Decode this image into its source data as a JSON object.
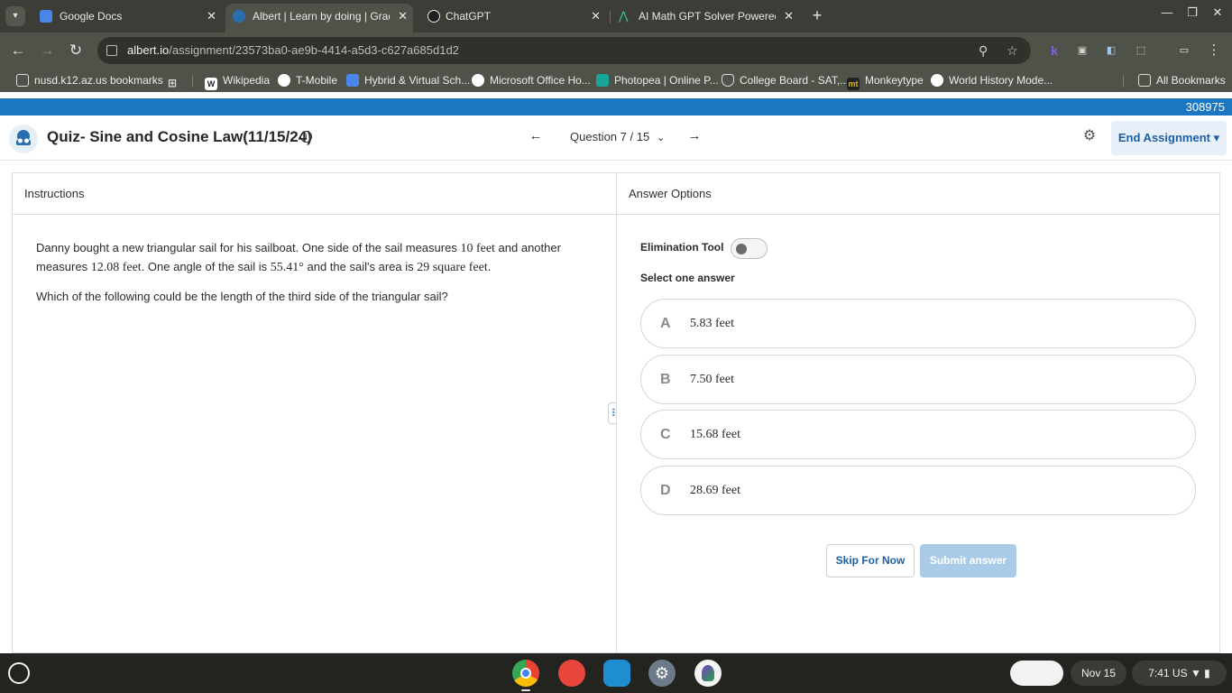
{
  "browser": {
    "tabs": [
      {
        "title": "Google Docs",
        "active": false
      },
      {
        "title": "Albert | Learn by doing | Grades",
        "active": true
      },
      {
        "title": "ChatGPT",
        "active": false
      },
      {
        "title": "AI Math GPT Solver Powered by",
        "active": false
      }
    ],
    "url_host": "albert.io",
    "url_path": "/assignment/23573ba0-ae9b-4414-a5d3-c627a685d1d2",
    "bookmarks": [
      "nusd.k12.az.us bookmarks",
      "Wikipedia",
      "T-Mobile",
      "Hybrid & Virtual Sch...",
      "Microsoft Office Ho...",
      "Photopea | Online P...",
      "College Board - SAT,...",
      "Monkeytype",
      "World History Mode...",
      "All Bookmarks"
    ]
  },
  "page": {
    "top_code": "308975",
    "header": {
      "title": "Quiz- Sine and Cosine Law(11/15/24)",
      "question_nav": "Question 7 / 15",
      "end_label": "End Assignment"
    },
    "instructions": {
      "heading": "Instructions",
      "p1_a": "Danny bought a new triangular sail for his sailboat. One side of the sail measures ",
      "p1_m1": "10 feet",
      "p1_b": " and another measures ",
      "p1_m2": "12.08 feet",
      "p1_c": ". One angle of the sail is ",
      "p1_m3": "55.41°",
      "p1_d": " and the sail's area is ",
      "p1_m4": "29 square feet",
      "p1_e": ".",
      "question": "Which of the following could be the length of the third side of the triangular sail?"
    },
    "answers": {
      "heading": "Answer Options",
      "elimination_label": "Elimination Tool",
      "select_label": "Select one answer",
      "options": [
        {
          "letter": "A",
          "text": "5.83 feet"
        },
        {
          "letter": "B",
          "text": "7.50 feet"
        },
        {
          "letter": "C",
          "text": "15.68 feet"
        },
        {
          "letter": "D",
          "text": "28.69 feet"
        }
      ],
      "skip_label": "Skip For Now",
      "submit_label": "Submit answer"
    }
  },
  "taskbar": {
    "date": "Nov 15",
    "time": "7:41",
    "locale": "US"
  },
  "colors": {
    "brand_blue": "#1c77c3",
    "link_blue": "#1d5fa3",
    "submit_disabled": "#a9cbe8"
  }
}
